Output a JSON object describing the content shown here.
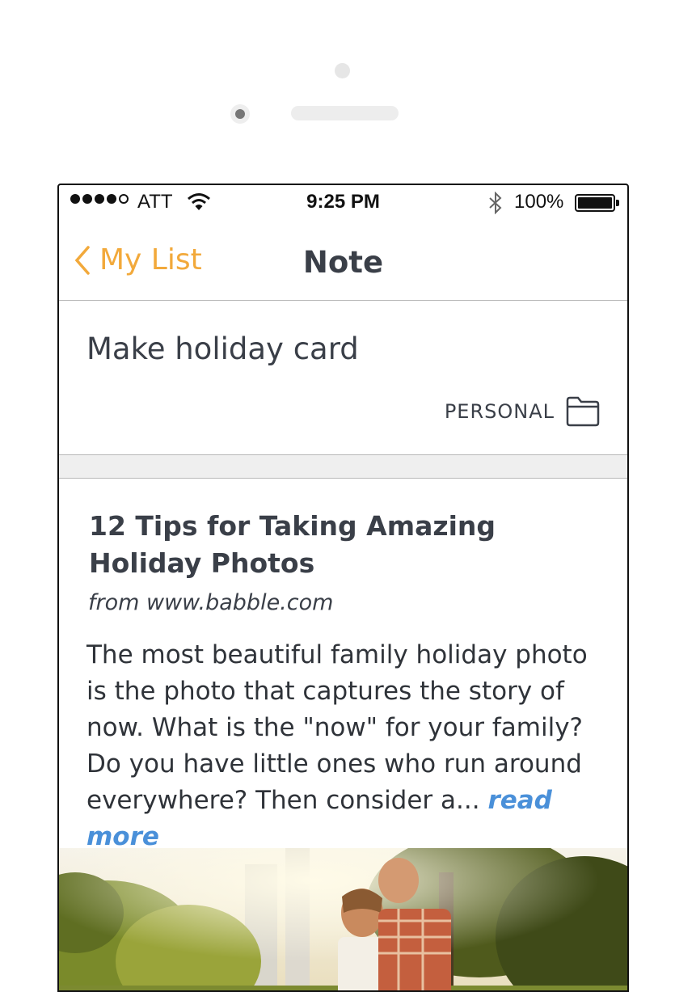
{
  "status_bar": {
    "carrier": "ATT",
    "time": "9:25 PM",
    "battery_percent": "100%",
    "signal_bars": 4,
    "signal_total": 5
  },
  "nav": {
    "back_label": "My List",
    "title": "Note"
  },
  "note": {
    "title": "Make holiday card",
    "category": "PERSONAL"
  },
  "article": {
    "title": "12 Tips for Taking Amazing Holiday Photos",
    "source": "from www.babble.com",
    "excerpt": "The most beautiful family holiday photo is the photo that captures the story of now. What is the \"now\" for your family?  Do you have little ones who run around everywhere?  Then consider a...",
    "read_more": "read more"
  },
  "colors": {
    "accent": "#f2a93b",
    "link": "#4a90d9",
    "text": "#3a3f48"
  }
}
